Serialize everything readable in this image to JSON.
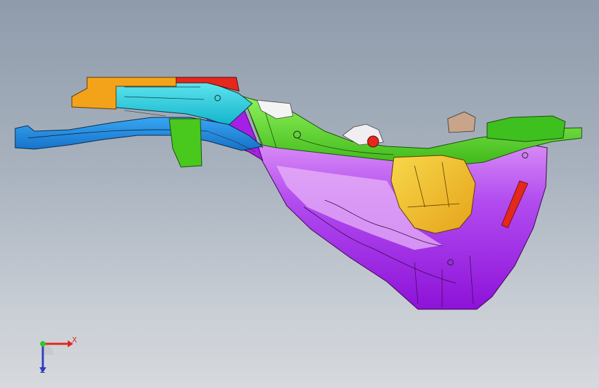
{
  "triad": {
    "x_label": "X",
    "z_label": "Z",
    "colors": {
      "x": "#e0261d",
      "y": "#2ec82e",
      "z": "#2f3fc4"
    }
  },
  "model": {
    "icon": "car-underbody-frame-icon",
    "palette": {
      "purple": "#a21ee8",
      "light_purple": "#d98cf5",
      "green": "#4fd11d",
      "light_green": "#9ef06a",
      "cyan": "#16d4e0",
      "blue": "#1a8ee8",
      "orange": "#f3a31a",
      "yellow": "#f2cf2a",
      "red": "#e4281c",
      "white": "#f4f4f4",
      "dark_green": "#2e8f2a"
    }
  }
}
